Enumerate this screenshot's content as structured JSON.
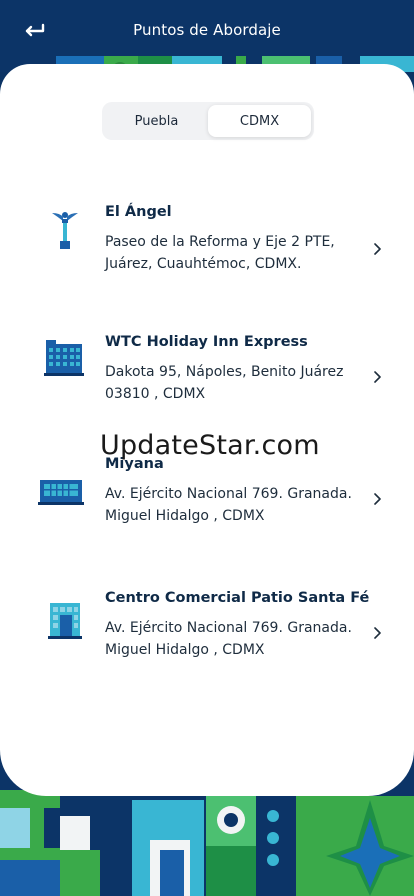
{
  "header": {
    "title": "Puntos de Abordaje",
    "back_icon": "back-arrow-icon"
  },
  "tabs": [
    {
      "label": "Puebla",
      "selected": false
    },
    {
      "label": "CDMX",
      "selected": true
    }
  ],
  "points": [
    {
      "name": "El Ángel",
      "address_line1": "Paseo de la Reforma y Eje 2 PTE,",
      "address_line2": "Juárez, Cuauhtémoc, CDMX.",
      "icon": "monument-icon"
    },
    {
      "name": "WTC Holiday Inn Express",
      "address_line1": "Dakota 95, Nápoles, Benito Juárez",
      "address_line2": "03810 , CDMX",
      "icon": "hotel-building-icon"
    },
    {
      "name": "Miyana",
      "address_line1": "Av. Ejército Nacional 769. Granada.",
      "address_line2": "Miguel Hidalgo , CDMX",
      "icon": "complex-building-icon"
    },
    {
      "name": "Centro Comercial Patio Santa Fé",
      "address_line1": "Av. Ejército Nacional 769. Granada.",
      "address_line2": "Miguel Hidalgo , CDMX",
      "icon": "mall-building-icon"
    }
  ],
  "watermark": "UpdateStar.com",
  "colors": {
    "header_bg": "#0c3467",
    "accent_blue": "#1a5fa8",
    "icon_teal": "#39b6d3",
    "pattern_green": "#3aaa4a"
  }
}
